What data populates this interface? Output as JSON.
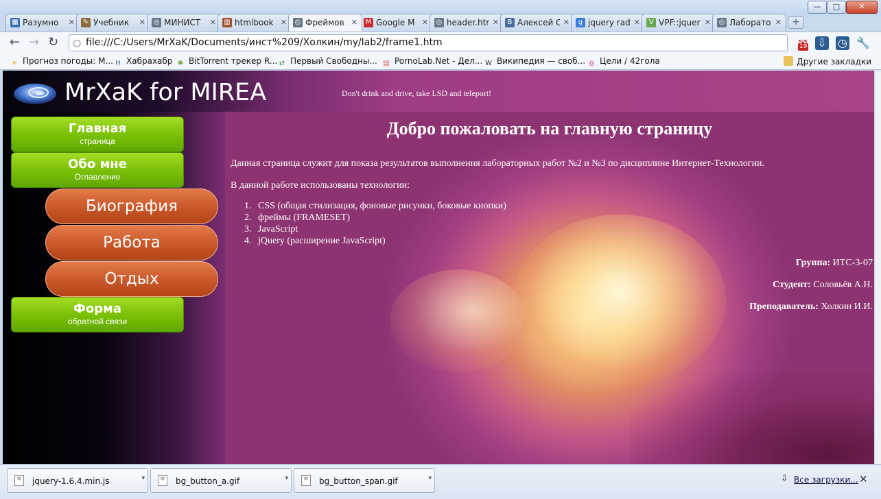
{
  "tabs": [
    {
      "title": "Разумно",
      "icon": "ruler-icon",
      "color": "#3a6db5"
    },
    {
      "title": "Учебник",
      "icon": "pencil-icon",
      "color": "#8a6c3c"
    },
    {
      "title": "МИНИСТ",
      "icon": "globe-icon",
      "color": "#667788"
    },
    {
      "title": "htmlbook",
      "icon": "grid-icon",
      "color": "#a0522d"
    },
    {
      "title": "Фреймов",
      "icon": "globe-icon",
      "color": "#667788",
      "active": true
    },
    {
      "title": "Google M",
      "icon": "gmail-icon",
      "color": "#cc2a2a"
    },
    {
      "title": "header.htr",
      "icon": "globe-icon",
      "color": "#667788"
    },
    {
      "title": "Алексей С",
      "icon": "vk-icon",
      "color": "#4a6e99"
    },
    {
      "title": "jquery rad",
      "icon": "google-icon",
      "color": "#3b7de0"
    },
    {
      "title": "VPF::jquer",
      "icon": "v-icon",
      "color": "#6aa84f"
    },
    {
      "title": "Лаборато",
      "icon": "globe-icon",
      "color": "#667788"
    }
  ],
  "toolbar": {
    "url": "file:///C:/Users/MrXaK/Documents/инст%209/Холкин/my/lab2/frame1.htm",
    "mail_badge": "19"
  },
  "bookmarks": [
    {
      "label": "Прогноз погоды: М...",
      "icon": "weather-icon",
      "color": "#f29f1c"
    },
    {
      "label": "Хабрахабр",
      "icon": "habr-icon",
      "color": "#4a6b8a"
    },
    {
      "label": "BitTorrent трекер R...",
      "icon": "torrent-icon",
      "color": "#7aa23c"
    },
    {
      "label": "Первый Свободны...",
      "icon": "arrows-icon",
      "color": "#2c8a3a"
    },
    {
      "label": "PornoLab.Net - Дел...",
      "icon": "page-icon",
      "color": "#d55"
    },
    {
      "label": "Википедия — своб...",
      "icon": "wiki-icon",
      "color": "#333"
    },
    {
      "label": "Цели / 42гола",
      "icon": "target-icon",
      "color": "#d0307a"
    }
  ],
  "bookmarks_other": "Другие закладки",
  "site": {
    "title": "MrXaK for MIREA",
    "slogan": "Don't drink and drive, take LSD and teleport!"
  },
  "menu": {
    "home_main": "Главная",
    "home_sub": "страница",
    "about_main": "Обо мне",
    "about_sub": "Оглавление",
    "bio": "Биография",
    "work": "Работа",
    "rest": "Отдых",
    "form_main": "Форма",
    "form_sub": "обратной связи"
  },
  "content": {
    "heading": "Добро пожаловать на главную страницу",
    "intro": "Данная страница служит для показа результатов выполнения лабораторных работ №2 и №3 по дисциплине Интернет-Технологии.",
    "tech_intro": "В данной работе использованы технологии:",
    "tech_list": [
      "CSS (общая стилизация, фоновые рисунки, боковые кнопки)",
      "фреймы (FRAMESET)",
      "JavaScript",
      "jQuery (расширение JavaScript)"
    ],
    "group_label": "Группа:",
    "group_value": "ИТС-3-07",
    "student_label": "Студент:",
    "student_value": "Соловьёв А.Н.",
    "teacher_label": "Преподаватель:",
    "teacher_value": "Холкин И.И."
  },
  "downloads": [
    {
      "name": "jquery-1.6.4.min.js"
    },
    {
      "name": "bg_button_a.gif"
    },
    {
      "name": "bg_button_span.gif"
    }
  ],
  "downloads_all": "Все загрузки..."
}
